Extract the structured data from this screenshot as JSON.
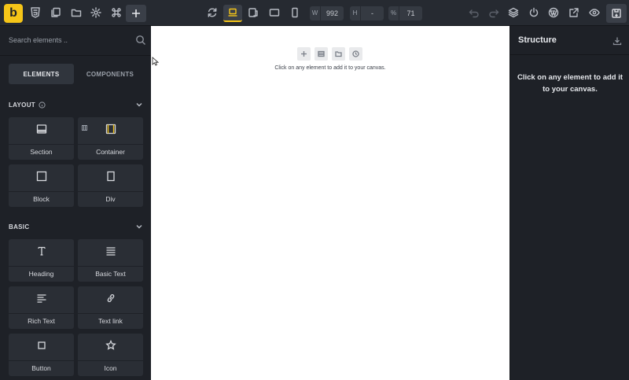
{
  "topbar": {
    "logo_letter": "b",
    "width_key": "W",
    "width_value": "992",
    "height_key": "H",
    "height_value": "-",
    "zoom_key": "%",
    "zoom_value": "71"
  },
  "left_panel": {
    "search_placeholder": "Search elements ..",
    "tabs": [
      {
        "label": "ELEMENTS",
        "active": true
      },
      {
        "label": "COMPONENTS",
        "active": false
      }
    ],
    "sections": [
      {
        "title": "LAYOUT",
        "items": [
          {
            "label": "Section",
            "icon": "section-icon"
          },
          {
            "label": "Container",
            "icon": "container-icon"
          },
          {
            "label": "Block",
            "icon": "block-icon"
          },
          {
            "label": "Div",
            "icon": "div-icon"
          }
        ]
      },
      {
        "title": "BASIC",
        "items": [
          {
            "label": "Heading",
            "icon": "heading-icon"
          },
          {
            "label": "Basic Text",
            "icon": "basic-text-icon"
          },
          {
            "label": "Rich Text",
            "icon": "rich-text-icon"
          },
          {
            "label": "Text link",
            "icon": "link-icon"
          },
          {
            "label": "Button",
            "icon": "button-icon"
          },
          {
            "label": "Icon",
            "icon": "star-icon"
          }
        ]
      }
    ]
  },
  "canvas": {
    "hint": "Click on any element to add it to your canvas."
  },
  "structure_panel": {
    "title": "Structure",
    "message": "Click on any element to add it to your canvas."
  },
  "colors": {
    "accent": "#f5c518",
    "panel_bg": "#1e2127",
    "topbar_bg": "#262a31",
    "tile_bg": "#2a2e35",
    "canvas_bg": "#ffffff"
  }
}
